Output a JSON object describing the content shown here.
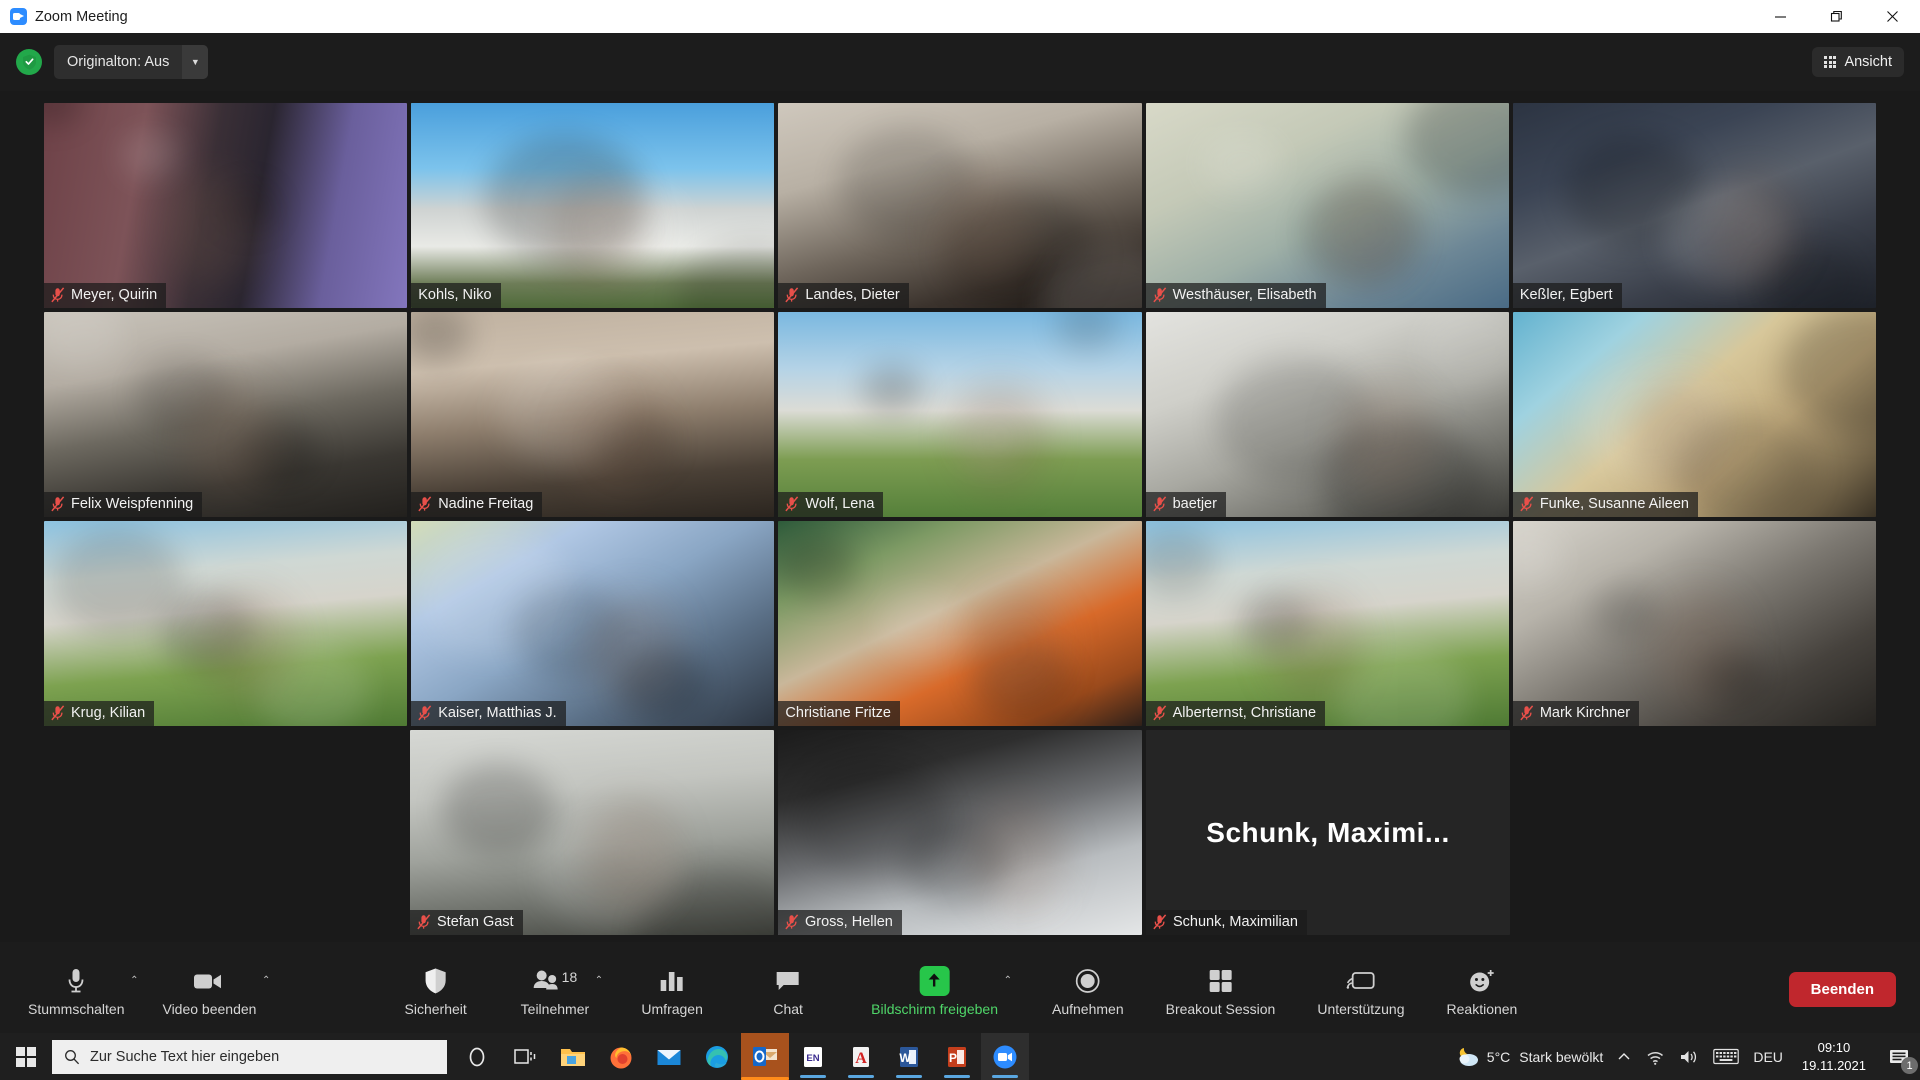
{
  "window": {
    "title": "Zoom Meeting",
    "app_icon": "zoom-video-icon",
    "minimize_label": "Minimieren",
    "restore_label": "Wiederherstellen",
    "close_label": "Schließen"
  },
  "topbar": {
    "security_icon": "shield-check-icon",
    "original_sound_label": "Originalton: Aus",
    "original_sound_caret": "▼",
    "view_icon": "grid-icon",
    "view_label": "Ansicht"
  },
  "gallery": {
    "rows": [
      [
        {
          "name": "Meyer, Quirin",
          "muted": true,
          "speaking": false,
          "video": true,
          "bg": "bg-room1",
          "name_on_dark": false
        },
        {
          "name": "Kohls, Niko",
          "muted": false,
          "speaking": true,
          "video": true,
          "bg": "bg-hsc",
          "name_on_dark": false
        },
        {
          "name": "Landes, Dieter",
          "muted": true,
          "speaking": false,
          "video": true,
          "bg": "bg-office1",
          "name_on_dark": false
        },
        {
          "name": "Westhäuser, Elisabeth",
          "muted": true,
          "speaking": false,
          "video": true,
          "bg": "bg-bright1",
          "name_on_dark": false
        },
        {
          "name": "Keßler, Egbert",
          "muted": false,
          "speaking": false,
          "video": true,
          "bg": "bg-dark1",
          "name_on_dark": false
        }
      ],
      [
        {
          "name": "Felix Weispfenning",
          "muted": true,
          "speaking": false,
          "video": true,
          "bg": "bg-room2",
          "name_on_dark": false
        },
        {
          "name": "Nadine Freitag",
          "muted": true,
          "speaking": false,
          "video": true,
          "bg": "bg-room3",
          "name_on_dark": false
        },
        {
          "name": "Wolf, Lena",
          "muted": true,
          "speaking": false,
          "video": true,
          "bg": "bg-room7",
          "name_on_dark": false
        },
        {
          "name": "baetjer",
          "muted": true,
          "speaking": false,
          "video": true,
          "bg": "bg-room5",
          "name_on_dark": false
        },
        {
          "name": "Funke, Susanne Aileen",
          "muted": true,
          "speaking": false,
          "video": true,
          "bg": "bg-room6",
          "name_on_dark": false
        }
      ],
      [
        {
          "name": "Krug, Kilian",
          "muted": true,
          "speaking": false,
          "video": true,
          "bg": "bg-room10",
          "name_on_dark": false
        },
        {
          "name": "Kaiser, Matthias J.",
          "muted": true,
          "speaking": false,
          "video": true,
          "bg": "bg-room4",
          "name_on_dark": false
        },
        {
          "name": "Christiane Fritze",
          "muted": false,
          "speaking": false,
          "video": true,
          "bg": "bg-room9",
          "name_on_dark": false
        },
        {
          "name": "Alberternst, Christiane",
          "muted": true,
          "speaking": false,
          "video": true,
          "bg": "bg-room10",
          "name_on_dark": false
        },
        {
          "name": "Mark Kirchner",
          "muted": true,
          "speaking": false,
          "video": true,
          "bg": "bg-room11",
          "name_on_dark": false
        }
      ],
      [
        {
          "name": "Stefan Gast",
          "muted": true,
          "speaking": false,
          "video": true,
          "bg": "bg-room12",
          "name_on_dark": false
        },
        {
          "name": "Gross, Hellen",
          "muted": true,
          "speaking": false,
          "video": true,
          "bg": "bg-room13",
          "name_on_dark": false
        },
        {
          "name": "Schunk, Maximilian",
          "muted": true,
          "speaking": false,
          "video": false,
          "bg": "bg-novideo",
          "display_name": "Schunk,  Maximi...",
          "name_on_dark": true
        }
      ]
    ]
  },
  "controls": {
    "mute": {
      "label": "Stummschalten",
      "icon": "microphone-icon",
      "caret": "⌃"
    },
    "video": {
      "label": "Video beenden",
      "icon": "camera-icon",
      "caret": "⌃"
    },
    "security": {
      "label": "Sicherheit",
      "icon": "shield-icon"
    },
    "participants": {
      "label": "Teilnehmer",
      "icon": "participants-icon",
      "count": "18",
      "caret": "⌃"
    },
    "polls": {
      "label": "Umfragen",
      "icon": "bar-chart-icon"
    },
    "chat": {
      "label": "Chat",
      "icon": "chat-bubble-icon"
    },
    "share": {
      "label": "Bildschirm freigeben",
      "icon": "share-screen-icon",
      "caret": "⌃",
      "accent": "#27c64a"
    },
    "record": {
      "label": "Aufnehmen",
      "icon": "record-circle-icon"
    },
    "breakout": {
      "label": "Breakout Session",
      "icon": "breakout-grid-icon"
    },
    "support": {
      "label": "Unterstützung",
      "icon": "remote-support-icon"
    },
    "reactions": {
      "label": "Reaktionen",
      "icon": "smiley-plus-icon"
    },
    "end": {
      "label": "Beenden",
      "color": "#c0272d"
    }
  },
  "taskbar": {
    "start_icon": "windows-logo-icon",
    "search_placeholder": "Zur Suche Text hier eingeben",
    "search_icon": "search-icon",
    "pinned": [
      {
        "name": "cortana-icon",
        "running": false
      },
      {
        "name": "task-view-icon",
        "running": false
      },
      {
        "name": "file-explorer-icon",
        "running": true
      },
      {
        "name": "firefox-icon",
        "running": true
      },
      {
        "name": "mail-icon",
        "running": false
      },
      {
        "name": "edge-icon",
        "running": false
      },
      {
        "name": "outlook-icon",
        "running": true,
        "highlighted": true
      },
      {
        "name": "endnote-icon",
        "running": true
      },
      {
        "name": "acrobat-reader-icon",
        "running": true
      },
      {
        "name": "word-icon",
        "running": true
      },
      {
        "name": "powerpoint-icon",
        "running": true
      },
      {
        "name": "zoom-icon",
        "running": true,
        "active": true
      }
    ],
    "weather": {
      "icon": "partly-cloudy-night-icon",
      "temperature": "5°C",
      "condition": "Stark bewölkt"
    },
    "tray": [
      {
        "name": "show-hidden-icons-chevron",
        "glyph": "⌃"
      },
      {
        "name": "network-wifi-icon"
      },
      {
        "name": "volume-icon"
      },
      {
        "name": "touch-keyboard-icon"
      }
    ],
    "language": "DEU",
    "clock_time": "09:10",
    "clock_date": "19.11.2021",
    "notifications": {
      "icon": "action-center-icon",
      "count": "1"
    }
  },
  "colors": {
    "speaking_border": "#b6e222",
    "end_button": "#c0272d",
    "share_green": "#27c64a",
    "mute_red": "#e8504a",
    "chrome_dark": "#1c1c1c",
    "gallery_bg": "#1a1a1a",
    "taskbar": "#1f1f1f"
  }
}
